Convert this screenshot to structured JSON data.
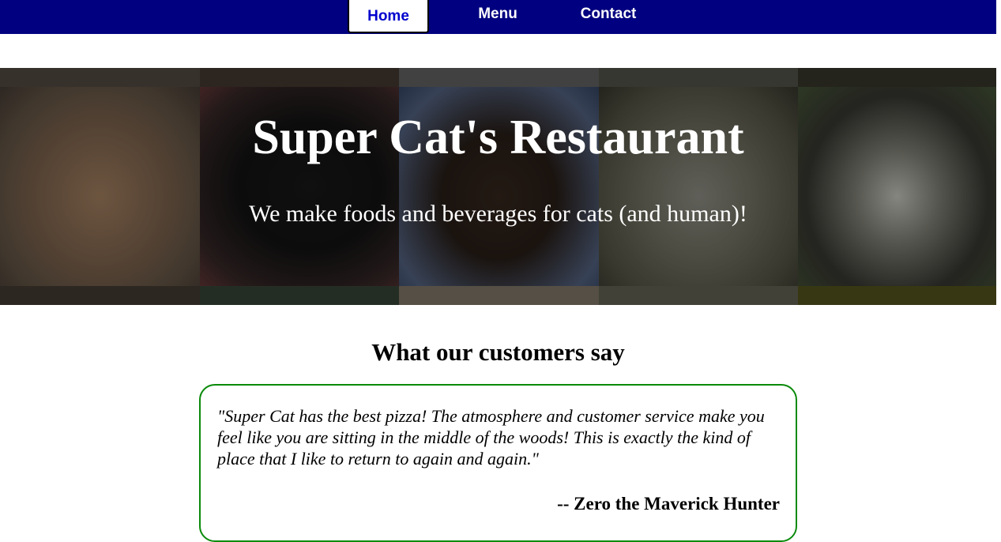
{
  "nav": {
    "items": [
      {
        "label": "Home",
        "active": true
      },
      {
        "label": "Menu",
        "active": false
      },
      {
        "label": "Contact",
        "active": false
      }
    ],
    "background": "#000080",
    "active_text_color": "#0000cd"
  },
  "hero": {
    "title": "Super Cat's Restaurant",
    "subtitle": "We make foods and beverages for cats (and human)!",
    "images": [
      "orange-tabby-cat",
      "black-cat",
      "siamese-cat",
      "tabby-white-cat",
      "calico-cat"
    ]
  },
  "testimonials": {
    "heading": "What our customers say",
    "border_color": "#0a8a0a",
    "items": [
      {
        "quote": "\"Super Cat has the best pizza! The atmosphere and customer service make you feel like you are sitting in the middle of the woods! This is exactly the kind of place that I like to return to again and again.\"",
        "author": "-- Zero the Maverick Hunter"
      }
    ]
  }
}
